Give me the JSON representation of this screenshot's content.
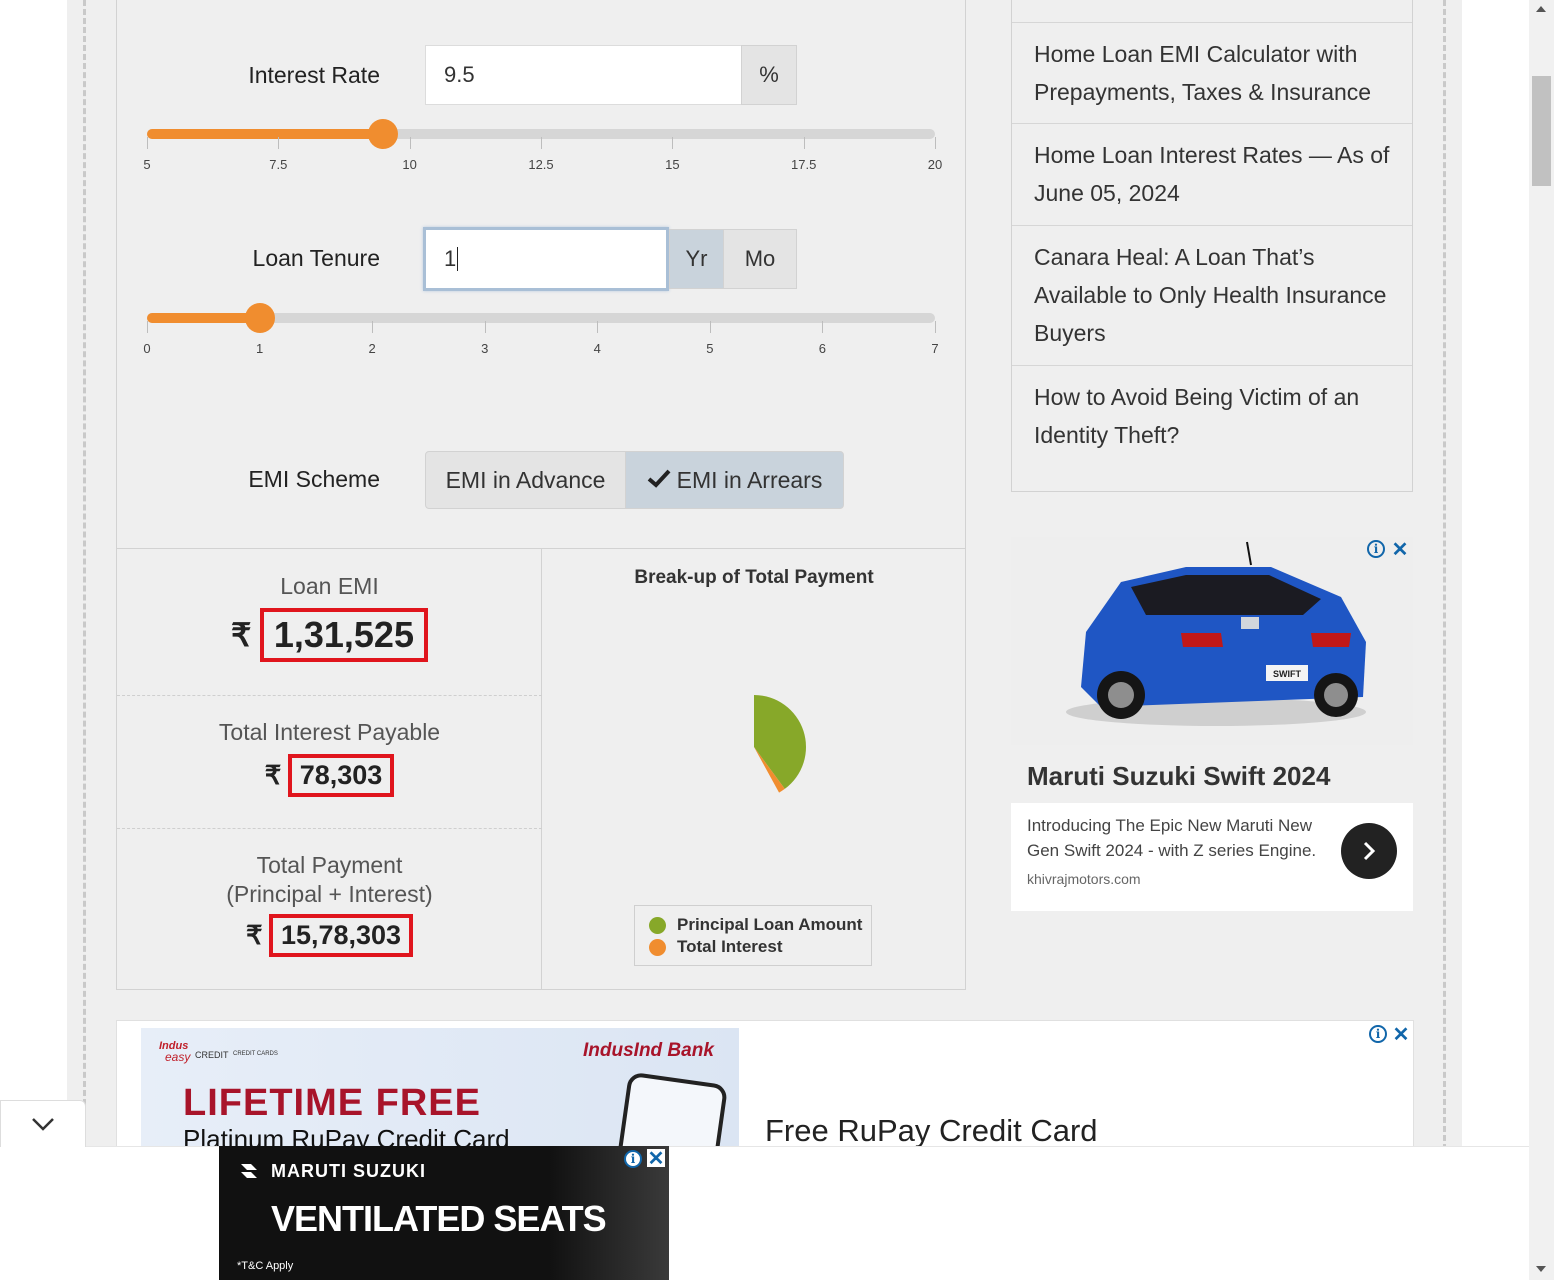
{
  "calculator": {
    "interest_rate": {
      "label": "Interest Rate",
      "value": "9.5",
      "unit": "%",
      "slider_value": 9.5,
      "slider_min": 5,
      "slider_max": 20,
      "ticks": [
        "5",
        "7.5",
        "10",
        "12.5",
        "15",
        "17.5",
        "20"
      ]
    },
    "loan_tenure": {
      "label": "Loan Tenure",
      "value": "1",
      "unit_year": "Yr",
      "unit_month": "Mo",
      "selected_unit": "Yr",
      "slider_value": 1,
      "slider_min": 0,
      "slider_max": 7,
      "ticks": [
        "0",
        "1",
        "2",
        "3",
        "4",
        "5",
        "6",
        "7"
      ]
    },
    "emi_scheme": {
      "label": "EMI Scheme",
      "option_advance": "EMI in Advance",
      "option_arrears": "EMI in Arrears",
      "selected": "EMI in Arrears"
    },
    "results": {
      "currency": "₹",
      "loan_emi_label": "Loan EMI",
      "loan_emi_value": "1,31,525",
      "total_interest_label": "Total Interest Payable",
      "total_interest_value": "78,303",
      "total_payment_label_line1": "Total Payment",
      "total_payment_label_line2": "(Principal + Interest)",
      "total_payment_value": "15,78,303"
    },
    "chart": {
      "title": "Break-up of Total Payment",
      "legend_principal": "Principal Loan Amount",
      "legend_interest": "Total Interest",
      "color_principal": "#87a829",
      "color_interest": "#f08d2f"
    }
  },
  "sidebar": {
    "links": [
      "Home Loan EMI Calculator with Prepayments, Taxes & Insurance",
      "Home Loan Interest Rates — As of June 05, 2024",
      "Canara Heal: A Loan That’s Available to Only Health Insurance Buyers",
      "How to Avoid Being Victim of an Identity Theft?"
    ]
  },
  "ads": {
    "sidebar_ad": {
      "headline": "Maruti Suzuki Swift 2024",
      "text": "Introducing The Epic New Maruti New Gen Swift 2024 - with Z series Engine.",
      "domain": "khivrajmotors.com",
      "plate": "SWIFT"
    },
    "content_ad": {
      "brand_small": "Indus",
      "brand_easy": "easy",
      "brand_credit": "CREDIT",
      "brand_cards": "CREDIT CARDS",
      "bank": "IndusInd Bank",
      "headline": "LIFETIME FREE",
      "subline": "Platinum RuPay Credit Card",
      "title": "Free RuPay Credit Card"
    },
    "bottom_ad": {
      "brand": "MARUTI SUZUKI",
      "headline": "VENTILATED SEATS",
      "note": "*T&C Apply"
    }
  },
  "colors": {
    "accent_orange": "#f08d2f",
    "highlight_red": "#e0151d",
    "chart_green": "#87a829"
  }
}
